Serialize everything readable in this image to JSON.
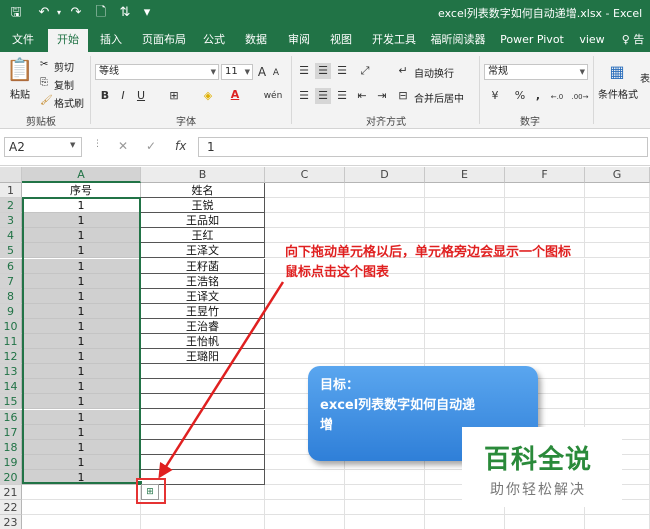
{
  "window": {
    "title": "excel列表数字如何自动递增.xlsx  -  Excel"
  },
  "quick_access": {
    "save": "🖫",
    "undo": "↶",
    "redo": "↷",
    "print_preview": "🗋",
    "sort": "⇅",
    "customize": "▾"
  },
  "tabs": [
    "文件",
    "开始",
    "插入",
    "页面布局",
    "公式",
    "数据",
    "审阅",
    "视图",
    "开发工具",
    "福昕阅读器",
    "Power Pivot",
    "view",
    "♀ 告"
  ],
  "active_tab_index": 1,
  "ribbon": {
    "clipboard": {
      "paste": "粘贴",
      "cut": "剪切",
      "copy": "复制",
      "format_painter": "格式刷",
      "label": "剪贴板"
    },
    "font": {
      "font_name": "等线",
      "font_size": "11",
      "grow": "A",
      "shrink": "A",
      "bold": "B",
      "italic": "I",
      "underline": "U",
      "border": "⊞",
      "fill": "◈",
      "color": "A",
      "phonetic": "wén",
      "label": "字体"
    },
    "alignment": {
      "wrap": "自动换行",
      "merge": "合并后居中",
      "label": "对齐方式"
    },
    "number": {
      "format": "常规",
      "currency": "¥",
      "percent": "%",
      "comma": ",",
      "inc_decimal": "←.0",
      "dec_decimal": ".00→",
      "label": "数字"
    },
    "styles": {
      "conditional": "条件格式",
      "table": "表"
    }
  },
  "formula_bar": {
    "name_box": "A2",
    "cancel": "✕",
    "enter": "✓",
    "fx": "fx",
    "value": "1"
  },
  "sheet": {
    "columns": [
      "A",
      "B",
      "C",
      "D",
      "E",
      "F",
      "G"
    ],
    "rows": [
      "1",
      "2",
      "3",
      "4",
      "5",
      "6",
      "7",
      "8",
      "9",
      "10",
      "11",
      "12",
      "13",
      "14",
      "15",
      "16",
      "17",
      "18",
      "19",
      "20",
      "21",
      "22",
      "23"
    ],
    "col_a": [
      "序号",
      "1",
      "1",
      "1",
      "1",
      "1",
      "1",
      "1",
      "1",
      "1",
      "1",
      "1",
      "1",
      "1",
      "1",
      "1",
      "1",
      "1",
      "1",
      "1",
      "",
      "",
      ""
    ],
    "col_b": [
      "姓名",
      "王锐",
      "王品如",
      "王红",
      "王泽文",
      "王籽菡",
      "王浩铭",
      "王译文",
      "王昱竹",
      "王治睿",
      "王怡帆",
      "王璐阳",
      "",
      "",
      "",
      "",
      "",
      "",
      "",
      "",
      "",
      "",
      ""
    ]
  },
  "autofill_icon": "⊞",
  "annotation": {
    "line1": "向下拖动单元格以后，单元格旁边会显示一个图标",
    "line2": "鼠标点击这个图表"
  },
  "goal_box": {
    "line1": "目标：",
    "line2": "excel列表数字如何自动递",
    "line3": "增"
  },
  "watermark": {
    "title": "百科全说",
    "subtitle": "助你轻松解决"
  },
  "colors": {
    "excel_green": "#217346",
    "annotation_red": "#e02020",
    "goal_blue": "#3a8be0"
  }
}
